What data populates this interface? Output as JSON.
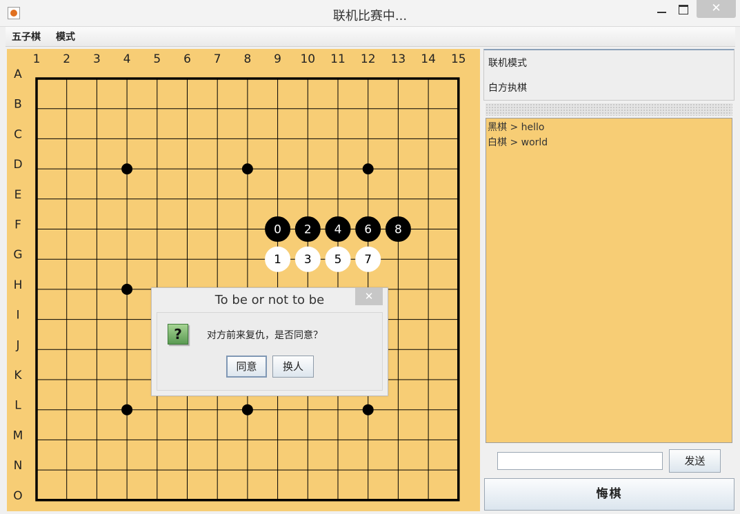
{
  "window": {
    "title": "联机比赛中..."
  },
  "menu": [
    "五子棋",
    "模式"
  ],
  "board": {
    "columns": [
      "1",
      "2",
      "3",
      "4",
      "5",
      "6",
      "7",
      "8",
      "9",
      "10",
      "11",
      "12",
      "13",
      "14",
      "15"
    ],
    "rows": [
      "A",
      "B",
      "C",
      "D",
      "E",
      "F",
      "G",
      "H",
      "I",
      "J",
      "K",
      "L",
      "M",
      "N",
      "O"
    ],
    "star_points": [
      [
        "D",
        4
      ],
      [
        "D",
        8
      ],
      [
        "D",
        12
      ],
      [
        "H",
        4
      ],
      [
        "L",
        4
      ],
      [
        "L",
        8
      ],
      [
        "L",
        12
      ]
    ],
    "stones": [
      {
        "row": "F",
        "col": 9,
        "color": "black",
        "label": "0"
      },
      {
        "row": "G",
        "col": 9,
        "color": "white",
        "label": "1"
      },
      {
        "row": "F",
        "col": 10,
        "color": "black",
        "label": "2"
      },
      {
        "row": "G",
        "col": 10,
        "color": "white",
        "label": "3"
      },
      {
        "row": "F",
        "col": 11,
        "color": "black",
        "label": "4"
      },
      {
        "row": "G",
        "col": 11,
        "color": "white",
        "label": "5"
      },
      {
        "row": "F",
        "col": 12,
        "color": "black",
        "label": "6"
      },
      {
        "row": "G",
        "col": 12,
        "color": "white",
        "label": "7"
      },
      {
        "row": "F",
        "col": 13,
        "color": "black",
        "label": "8"
      }
    ],
    "colors": {
      "wood": "#f7cd75",
      "line": "#000000"
    }
  },
  "info": {
    "mode": "联机模式",
    "side": "白方执棋"
  },
  "chat": {
    "messages": [
      "黑棋 > hello",
      "白棋 > world"
    ],
    "input_value": "",
    "send_label": "发送"
  },
  "undo_label": "悔棋",
  "dialog": {
    "title": "To be or not to be",
    "close_label": "✕",
    "icon": "question-icon",
    "icon_glyph": "?",
    "message": "对方前来复仇，是否同意？",
    "buttons": [
      "同意",
      "换人"
    ]
  }
}
